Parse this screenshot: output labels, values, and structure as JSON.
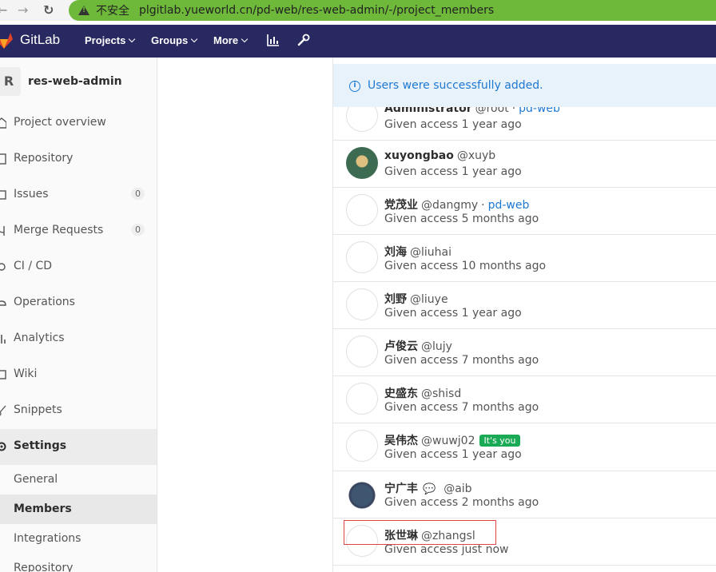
{
  "browser": {
    "security_label": "不安全",
    "url": "plgitlab.yueworld.cn/pd-web/res-web-admin/-/project_members"
  },
  "nav": {
    "brand": "GitLab",
    "items": [
      "Projects",
      "Groups",
      "More"
    ]
  },
  "sidebar": {
    "project_initial": "R",
    "project_name": "res-web-admin",
    "items": [
      {
        "label": "Project overview"
      },
      {
        "label": "Repository"
      },
      {
        "label": "Issues",
        "count": "0"
      },
      {
        "label": "Merge Requests",
        "count": "0"
      },
      {
        "label": "CI / CD"
      },
      {
        "label": "Operations"
      },
      {
        "label": "Analytics"
      },
      {
        "label": "Wiki"
      },
      {
        "label": "Snippets"
      },
      {
        "label": "Settings"
      }
    ],
    "settings_sub": [
      "General",
      "Members",
      "Integrations",
      "Repository"
    ]
  },
  "flash": {
    "message": "Users were successfully added."
  },
  "members": [
    {
      "name": "Administrator",
      "username": "@root",
      "group": "pd-web",
      "access": "Given access 1 year ago"
    },
    {
      "name": "xuyongbao",
      "username": "@xuyb",
      "access": "Given access 1 year ago"
    },
    {
      "name": "党茂业",
      "username": "@dangmy",
      "group": "pd-web",
      "access": "Given access 5 months ago"
    },
    {
      "name": "刘海",
      "username": "@liuhai",
      "access": "Given access 10 months ago"
    },
    {
      "name": "刘野",
      "username": "@liuye",
      "access": "Given access 1 year ago"
    },
    {
      "name": "卢俊云",
      "username": "@lujy",
      "access": "Given access 7 months ago"
    },
    {
      "name": "史盛东",
      "username": "@shisd",
      "access": "Given access 7 months ago"
    },
    {
      "name": "吴伟杰",
      "username": "@wuwj02",
      "badge": "It's you",
      "access": "Given access 1 year ago"
    },
    {
      "name": "宁广丰",
      "username": "@aib",
      "access": "Given access 2 months ago"
    },
    {
      "name": "张世琳",
      "username": "@zhangsl",
      "access": "Given access just now"
    }
  ]
}
